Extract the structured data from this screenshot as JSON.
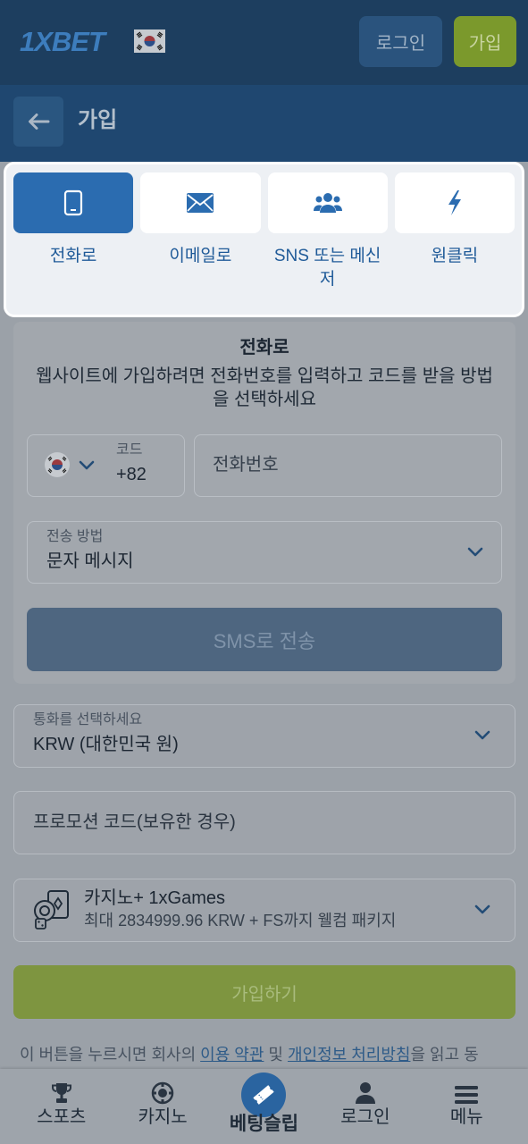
{
  "header": {
    "logo_text": "1XBET",
    "login_label": "로그인",
    "signup_label": "가입"
  },
  "subheader": {
    "title": "가입"
  },
  "methods": [
    {
      "label": "전화로",
      "icon": "phone-icon",
      "selected": true
    },
    {
      "label": "이메일로",
      "icon": "envelope-icon",
      "selected": false
    },
    {
      "label": "SNS 또는 메신저",
      "icon": "users-icon",
      "selected": false
    },
    {
      "label": "원클릭",
      "icon": "lightning-icon",
      "selected": false
    }
  ],
  "phone_form": {
    "title": "전화로",
    "description": "웹사이트에 가입하려면 전화번호를 입력하고 코드를 받을 방법을 선택하세요",
    "country_flag_icon": "korea-flag-icon",
    "code_label": "코드",
    "code_value": "+82",
    "phone_placeholder": "전화번호",
    "method_label": "전송 방법",
    "method_value": "문자 메시지",
    "send_button": "SMS로 전송"
  },
  "currency": {
    "label": "통화를 선택하세요",
    "value": "KRW (대한민국 원)"
  },
  "promo": {
    "placeholder": "프로모션 코드(보유한 경우)"
  },
  "bonus": {
    "icon": "casino-cards-icon",
    "title": "카지노+ 1xGames",
    "subtitle": "최대 2834999.96 KRW + FS까지 웰컴 패키지"
  },
  "submit_label": "가입하기",
  "terms": {
    "prefix": "이 버튼을 누르시면 회사의 ",
    "terms_link": "이용 약관",
    "middle": " 및 ",
    "privacy_link": "개인정보 처리방침",
    "suffix": "을 읽고 동"
  },
  "bottom_nav": [
    {
      "label": "스포츠",
      "icon": "trophy-icon"
    },
    {
      "label": "카지노",
      "icon": "casino-chip-icon"
    },
    {
      "label": "베팅슬립",
      "icon": "ticket-icon",
      "active": true
    },
    {
      "label": "로그인",
      "icon": "user-icon"
    },
    {
      "label": "메뉴",
      "icon": "menu-icon"
    }
  ],
  "colors": {
    "header_bg": "#1d3e5f",
    "accent_blue": "#2b6cb0",
    "signup_green": "#7b992c",
    "send_button_bg": "#4e6680",
    "submit_green": "#7e9540"
  }
}
